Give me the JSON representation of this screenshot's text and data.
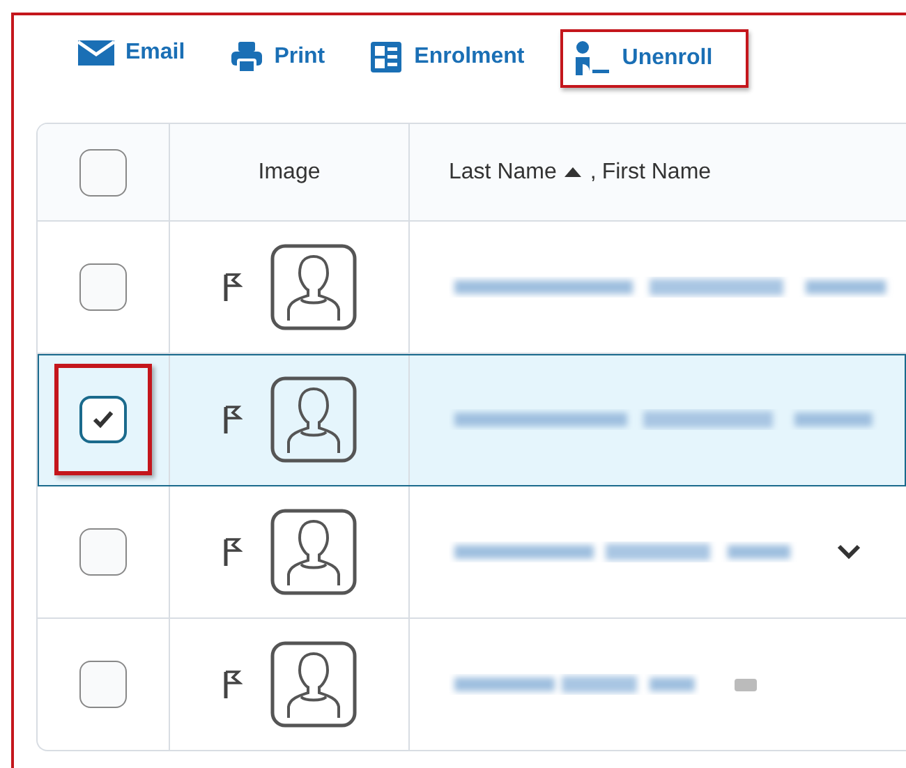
{
  "toolbar": [
    {
      "kind": "email",
      "label": "Email",
      "highlighted": false
    },
    {
      "kind": "print",
      "label": "Print",
      "highlighted": false
    },
    {
      "kind": "enrolment",
      "label": "Enrolment",
      "highlighted": false
    },
    {
      "kind": "unenroll",
      "label": "Unenroll",
      "highlighted": true
    }
  ],
  "table": {
    "select_all": {
      "checked": false
    },
    "columns": [
      "Image",
      "Last Name",
      "First Name"
    ],
    "name_separator": ",",
    "sort_ascending": true,
    "rows": [
      {
        "checked": false,
        "selected": false,
        "highlighted": false,
        "has_menu": false,
        "has_tag": false
      },
      {
        "checked": true,
        "selected": true,
        "highlighted": true,
        "has_menu": false,
        "has_tag": false
      },
      {
        "checked": false,
        "selected": false,
        "highlighted": false,
        "has_menu": true,
        "has_tag": false
      },
      {
        "checked": false,
        "selected": false,
        "highlighted": false,
        "has_menu": false,
        "has_tag": true
      }
    ]
  }
}
